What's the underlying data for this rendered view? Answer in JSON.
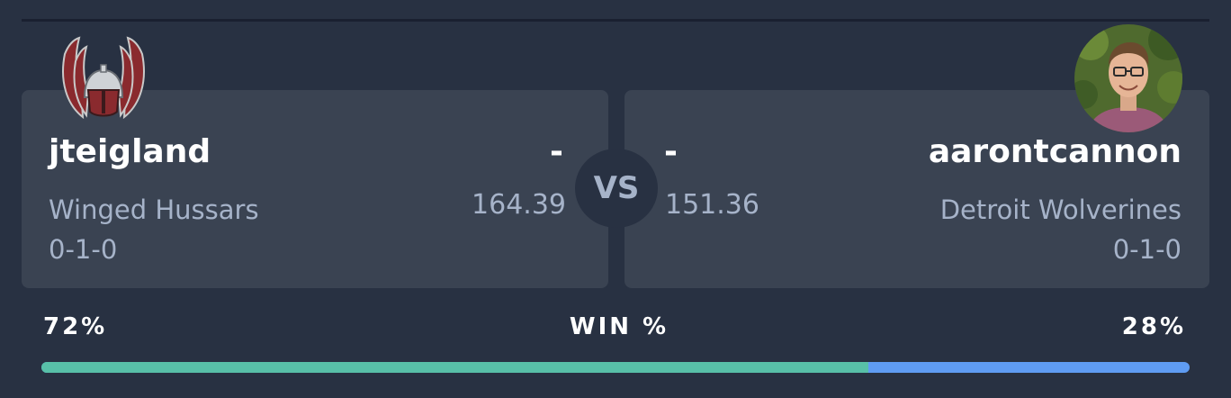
{
  "matchup": {
    "left": {
      "name": "jteigland",
      "team_name": "Winged Hussars",
      "record": "0-1-0",
      "score": "-",
      "projected": "164.39",
      "logo_icon": "winged-hussar-helmet-icon",
      "win_pct": 0.72,
      "win_pct_label": "72%"
    },
    "right": {
      "name": "aarontcannon",
      "team_name": "Detroit Wolverines",
      "record": "0-1-0",
      "score": "-",
      "projected": "151.36",
      "avatar_icon": "profile-photo-avatar",
      "win_pct": 0.28,
      "win_pct_label": "28%"
    },
    "vs_label": "VS",
    "win_title": "WIN %"
  },
  "colors": {
    "background": "#283142",
    "card": "#3a4352",
    "left_bar": "#58c0a8",
    "right_bar": "#5f9cf3",
    "muted_text": "#a6b3c9"
  }
}
